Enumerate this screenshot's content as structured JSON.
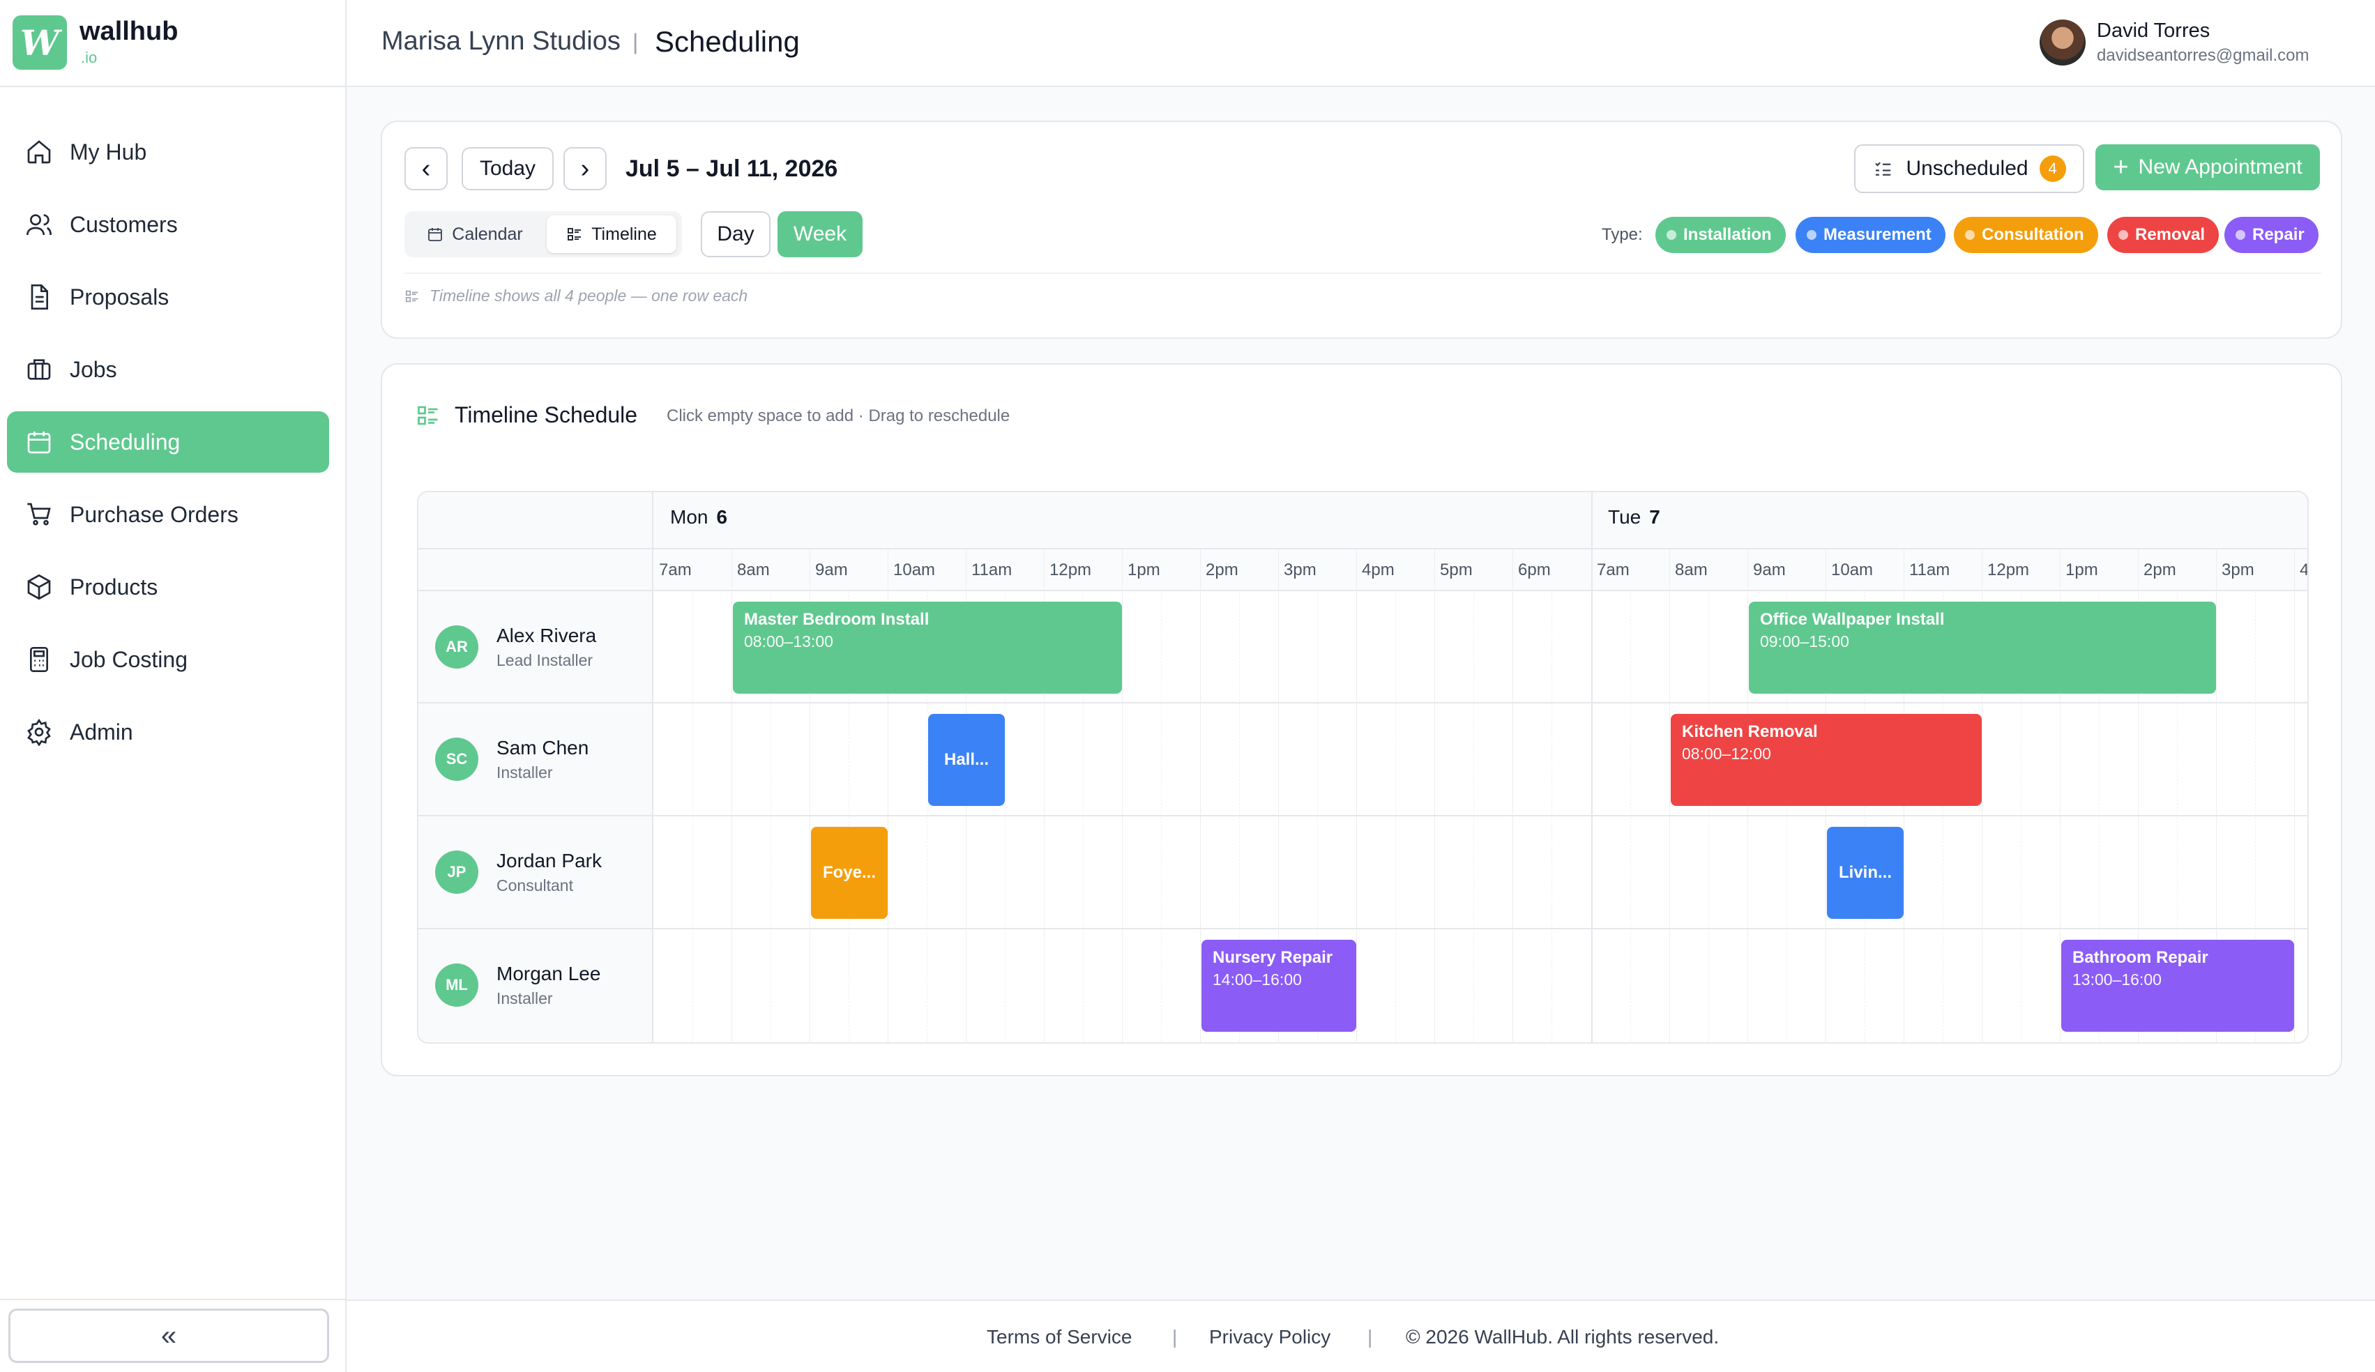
{
  "brand": {
    "name": "wallhub",
    "tld": ".io",
    "logo_glyph": "W"
  },
  "sidebar": {
    "items": [
      {
        "label": "My Hub",
        "icon": "home-icon",
        "active": false
      },
      {
        "label": "Customers",
        "icon": "users-icon",
        "active": false
      },
      {
        "label": "Proposals",
        "icon": "document-icon",
        "active": false
      },
      {
        "label": "Jobs",
        "icon": "briefcase-icon",
        "active": false
      },
      {
        "label": "Scheduling",
        "icon": "calendar-icon",
        "active": true
      },
      {
        "label": "Purchase Orders",
        "icon": "cart-icon",
        "active": false
      },
      {
        "label": "Products",
        "icon": "box-icon",
        "active": false
      },
      {
        "label": "Job Costing",
        "icon": "calculator-icon",
        "active": false
      },
      {
        "label": "Admin",
        "icon": "gear-icon",
        "active": false
      }
    ],
    "collapse_label": "«"
  },
  "header": {
    "studio": "Marisa Lynn Studios",
    "separator": "|",
    "title": "Scheduling",
    "user_name": "David Torres",
    "user_email": "davidseantorres@gmail.com"
  },
  "toolbar": {
    "prev": "‹",
    "today": "Today",
    "next": "›",
    "date_range": "Jul 5 – Jul 11, 2026",
    "view_calendar": "Calendar",
    "view_timeline": "Timeline",
    "day": "Day",
    "week": "Week",
    "unscheduled_label": "Unscheduled",
    "unscheduled_count": "4",
    "new_appointment": "New Appointment",
    "type_label": "Type:",
    "types": [
      {
        "label": "Installation",
        "color": "#5fc88f"
      },
      {
        "label": "Measurement",
        "color": "#3b82f6"
      },
      {
        "label": "Consultation",
        "color": "#f59e0b"
      },
      {
        "label": "Removal",
        "color": "#ef4444"
      },
      {
        "label": "Repair",
        "color": "#8b5cf6"
      }
    ],
    "hint": "Timeline shows all 4 people — one row each"
  },
  "timeline": {
    "title": "Timeline Schedule",
    "subtitle": "Click empty space to add · Drag to reschedule",
    "days": [
      {
        "name": "Mon",
        "num": "6"
      },
      {
        "name": "Tue",
        "num": "7"
      }
    ],
    "hours_mon": [
      "7am",
      "8am",
      "9am",
      "10am",
      "11am",
      "12pm",
      "1pm",
      "2pm",
      "3pm",
      "4pm",
      "5pm",
      "6pm"
    ],
    "hours_tue": [
      "7am",
      "8am",
      "9am",
      "10am",
      "11am",
      "12pm",
      "1pm",
      "2pm",
      "3pm",
      "4"
    ],
    "people": [
      {
        "initials": "AR",
        "name": "Alex Rivera",
        "role": "Lead Installer"
      },
      {
        "initials": "SC",
        "name": "Sam Chen",
        "role": "Installer"
      },
      {
        "initials": "JP",
        "name": "Jordan Park",
        "role": "Consultant"
      },
      {
        "initials": "ML",
        "name": "Morgan Lee",
        "role": "Installer"
      }
    ],
    "appointments": [
      {
        "row": 0,
        "day": 0,
        "start": 8,
        "end": 13,
        "title": "Master Bedroom Install",
        "time": "08:00–13:00",
        "color": "#5fc88f"
      },
      {
        "row": 0,
        "day": 1,
        "start": 9,
        "end": 15,
        "title": "Office Wallpaper Install",
        "time": "09:00–15:00",
        "color": "#5fc88f"
      },
      {
        "row": 1,
        "day": 0,
        "start": 10.5,
        "end": 11.5,
        "title": "Hall...",
        "time": "",
        "color": "#3b82f6"
      },
      {
        "row": 1,
        "day": 1,
        "start": 8,
        "end": 12,
        "title": "Kitchen Removal",
        "time": "08:00–12:00",
        "color": "#ef4444"
      },
      {
        "row": 2,
        "day": 0,
        "start": 9,
        "end": 10,
        "title": "Foye...",
        "time": "",
        "color": "#f59e0b"
      },
      {
        "row": 2,
        "day": 1,
        "start": 10,
        "end": 11,
        "title": "Livin...",
        "time": "",
        "color": "#3b82f6"
      },
      {
        "row": 3,
        "day": 0,
        "start": 14,
        "end": 16,
        "title": "Nursery Repair",
        "time": "14:00–16:00",
        "color": "#8b5cf6"
      },
      {
        "row": 3,
        "day": 1,
        "start": 13,
        "end": 16,
        "title": "Bathroom Repair",
        "time": "13:00–16:00",
        "color": "#8b5cf6"
      }
    ]
  },
  "footer": {
    "terms": "Terms of Service",
    "privacy": "Privacy Policy",
    "sep": "|",
    "copyright": "© 2026 WallHub. All rights reserved."
  }
}
